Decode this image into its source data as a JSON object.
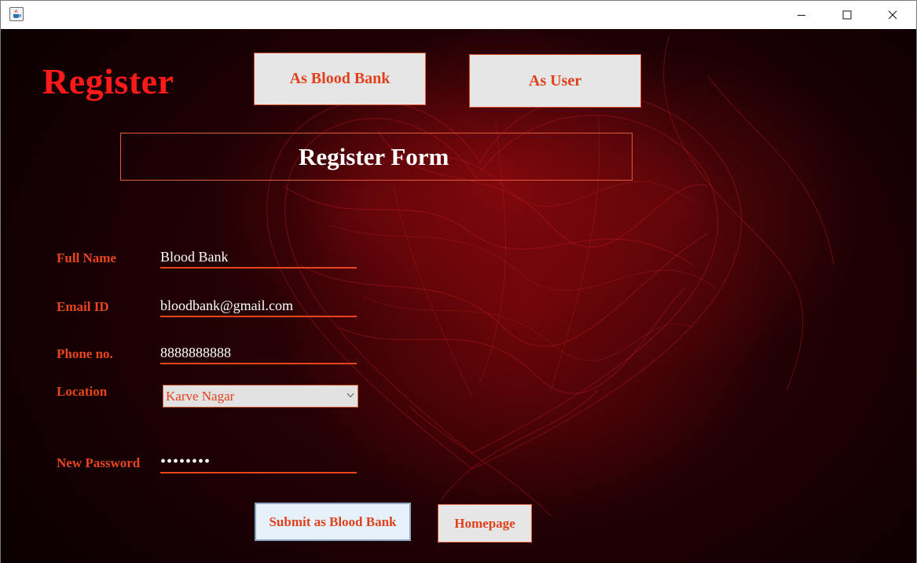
{
  "window": {
    "controls": {
      "minimize_icon": "minimize-icon",
      "maximize_icon": "maximize-icon",
      "close_icon": "close-icon"
    },
    "app_icon": "java-cup-icon"
  },
  "header": {
    "title": "Register",
    "btn_blood_bank": "As Blood Bank",
    "btn_user": "As User"
  },
  "form": {
    "banner": "Register Form",
    "full_name_label": "Full Name",
    "full_name_value": "Blood Bank",
    "email_label": "Email ID",
    "email_value": "bloodbank@gmail.com",
    "phone_label": "Phone no.",
    "phone_value": "8888888888",
    "location_label": "Location",
    "location_value": "Karve Nagar",
    "password_label": "New Password",
    "password_value": "••••••••"
  },
  "actions": {
    "submit": "Submit as Blood Bank",
    "homepage": "Homepage"
  },
  "colors": {
    "accent": "#e8451f",
    "title_red": "#ff1a1a",
    "button_bg": "#e6e6e6",
    "submit_bg": "#e6f1fb"
  }
}
